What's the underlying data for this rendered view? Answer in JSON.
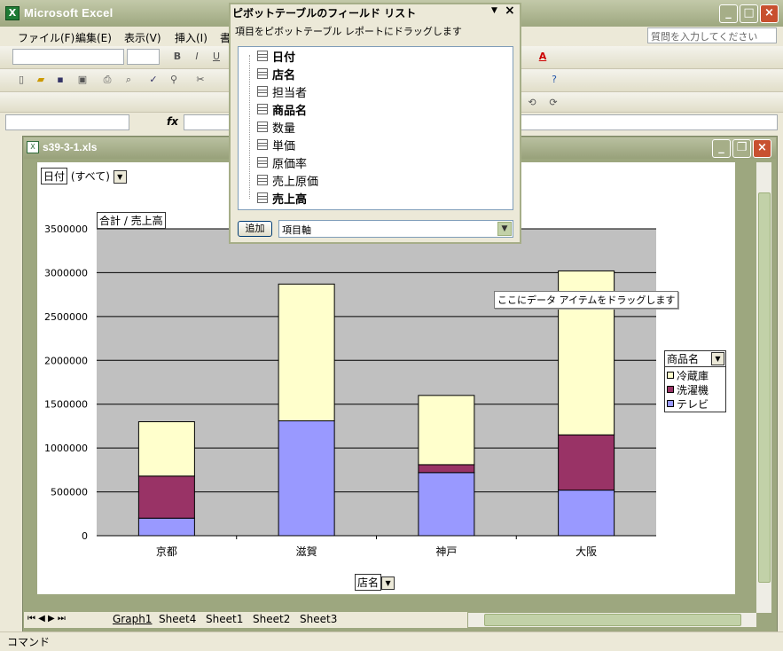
{
  "app": {
    "title": "Microsoft Excel",
    "icon_name": "excel-icon"
  },
  "menu": [
    "ファイル(F)",
    "編集(E)",
    "表示(V)",
    "挿入(I)",
    "書"
  ],
  "ask_placeholder": "質問を入力してください",
  "workbook": {
    "title": "s39-3-1.xls"
  },
  "pivot_panel": {
    "title": "ピボットテーブルのフィールド リスト",
    "subtitle": "項目をピボットテーブル レポートにドラッグします",
    "fields": [
      {
        "label": "日付",
        "bold": true
      },
      {
        "label": "店名",
        "bold": true
      },
      {
        "label": "担当者",
        "bold": false
      },
      {
        "label": "商品名",
        "bold": true
      },
      {
        "label": "数量",
        "bold": false
      },
      {
        "label": "単価",
        "bold": false
      },
      {
        "label": "原価率",
        "bold": false
      },
      {
        "label": "売上原価",
        "bold": false
      },
      {
        "label": "売上高",
        "bold": true
      }
    ],
    "add_label": "追加",
    "area_value": "項目軸"
  },
  "page_field": {
    "name": "日付",
    "value": "(すべて)"
  },
  "data_field": "合計 / 売上高",
  "drop_hint": "ここにデータ アイテムをドラッグします",
  "legend_field": "商品名",
  "category_field": "店名",
  "chart_data": {
    "type": "bar",
    "stacked": true,
    "categories": [
      "京都",
      "滋賀",
      "神戸",
      "大阪"
    ],
    "series": [
      {
        "name": "テレビ",
        "color": "#9999FF",
        "values": [
          200000,
          1310000,
          720000,
          520000
        ]
      },
      {
        "name": "洗濯機",
        "color": "#993366",
        "values": [
          480000,
          0,
          90000,
          630000
        ]
      },
      {
        "name": "冷蔵庫",
        "color": "#FFFFCC",
        "values": [
          620000,
          1560000,
          790000,
          1870000
        ]
      }
    ],
    "yticks": [
      "0",
      "500000",
      "1000000",
      "1500000",
      "2000000",
      "2500000",
      "3000000",
      "3500000"
    ],
    "ylim": [
      0,
      3500000
    ],
    "grid": true,
    "legend_position": "right"
  },
  "sheets": [
    "Graph1",
    "Sheet4",
    "Sheet1",
    "Sheet2",
    "Sheet3"
  ],
  "status": "コマンド"
}
